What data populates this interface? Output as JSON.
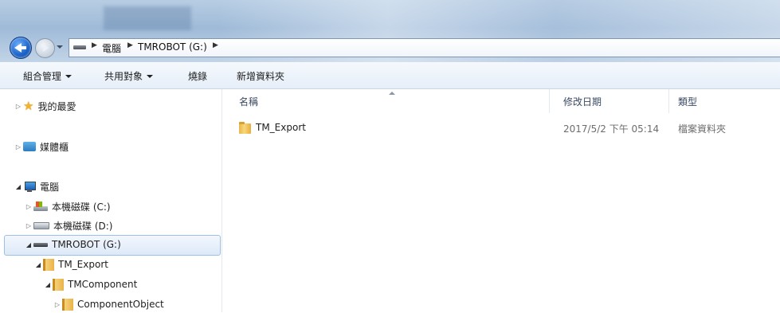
{
  "address_bar": {
    "crumbs": [
      "電腦",
      "TMROBOT (G:)"
    ]
  },
  "toolbar": {
    "organize": "組合管理",
    "share": "共用對象",
    "burn": "燒錄",
    "new_folder": "新增資料夾"
  },
  "nav_tree": {
    "favorites": "我的最愛",
    "libraries": "媒體櫃",
    "computer": "電腦",
    "drive_c": "本機磁碟 (C:)",
    "drive_d": "本機磁碟 (D:)",
    "drive_g": "TMROBOT (G:)",
    "folder_tm_export": "TM_Export",
    "folder_tmcomponent": "TMComponent",
    "folder_componentobject": "ComponentObject"
  },
  "file_list": {
    "columns": [
      "名稱",
      "修改日期",
      "類型"
    ],
    "rows": [
      {
        "name": "TM_Export",
        "modified": "2017/5/2 下午 05:14",
        "type": "檔案資料夾"
      }
    ]
  },
  "icons": {
    "back": "back-arrow-icon",
    "forward": "forward-arrow-icon",
    "favorites": "star-icon",
    "libraries": "library-icon",
    "computer": "computer-icon",
    "drive": "drive-icon",
    "folder": "folder-icon"
  },
  "colors": {
    "selection_fill": "#dde9f8",
    "selection_border": "#9cc0e8",
    "back_button": "#1c63c9",
    "folder": "#f8d77b"
  }
}
